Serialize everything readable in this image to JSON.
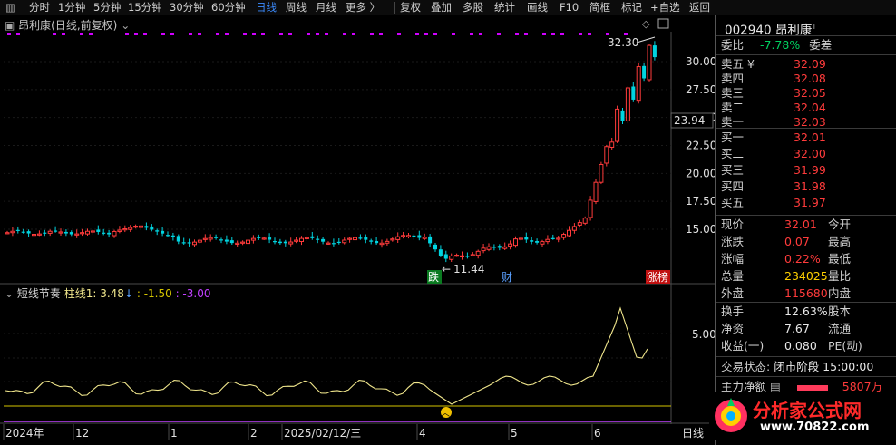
{
  "toolbar": {
    "items": [
      "分时",
      "1分钟",
      "5分钟",
      "15分钟",
      "30分钟",
      "60分钟",
      "日线",
      "周线",
      "月线",
      "更多 〉",
      "复权",
      "叠加",
      "多股",
      "统计",
      "画线",
      "F10",
      "简框",
      "标记",
      "+自选",
      "返回"
    ],
    "active": "日线"
  },
  "chart": {
    "title": "昂利康(日线,前复权)",
    "y_ticks": [
      "30.00",
      "27.50",
      "25.00",
      "22.50",
      "20.00",
      "17.50",
      "15.00"
    ],
    "cursor_price": "23.94",
    "high_label": "32.30",
    "low_label": "11.44",
    "markers": {
      "die": "跌",
      "cai": "财",
      "zhangbang": "涨榜"
    },
    "x_labels": [
      "2024年",
      "12",
      "1",
      "2",
      "2025/02/12/三",
      "4",
      "5",
      "6"
    ],
    "period_button": "日线"
  },
  "indicator": {
    "name": "短线节奏",
    "column_label": "柱线1: 3.48",
    "arrow": "↓",
    "value2": ": -1.50",
    "value3": ": -3.00",
    "y_tick": "5.00"
  },
  "panel": {
    "stock_code": "002940",
    "stock_name": "昂利康",
    "weibi_label": "委比",
    "weibi_value": "-7.78%",
    "weicha_label": "委差",
    "sell": [
      {
        "label": "卖五",
        "price": "32.09",
        "mark": "¥"
      },
      {
        "label": "卖四",
        "price": "32.08",
        "mark": ""
      },
      {
        "label": "卖三",
        "price": "32.05",
        "mark": ""
      },
      {
        "label": "卖二",
        "price": "32.04",
        "mark": ""
      },
      {
        "label": "卖一",
        "price": "32.03",
        "mark": ""
      }
    ],
    "buy": [
      {
        "label": "买一",
        "price": "32.01"
      },
      {
        "label": "买二",
        "price": "32.00"
      },
      {
        "label": "买三",
        "price": "31.99"
      },
      {
        "label": "买四",
        "price": "31.98"
      },
      {
        "label": "买五",
        "price": "31.97"
      }
    ],
    "stats": [
      {
        "l1": "现价",
        "v1": "32.01",
        "c1": "red",
        "l2": "今开"
      },
      {
        "l1": "涨跌",
        "v1": "0.07",
        "c1": "red",
        "l2": "最高"
      },
      {
        "l1": "涨幅",
        "v1": "0.22%",
        "c1": "red",
        "l2": "最低"
      },
      {
        "l1": "总量",
        "v1": "234025",
        "c1": "yellow",
        "l2": "量比"
      },
      {
        "l1": "外盘",
        "v1": "115680",
        "c1": "red",
        "l2": "内盘"
      }
    ],
    "stats2": [
      {
        "l1": "换手",
        "v1": "12.63%",
        "l2": "股本"
      },
      {
        "l1": "净资",
        "v1": "7.67",
        "l2": "流通"
      },
      {
        "l1": "收益(一)",
        "v1": "0.080",
        "l2": "PE(动)"
      }
    ],
    "status_label": "交易状态:",
    "status_value": "闭市阶段 15:00:00",
    "main_flow_label": "主力净额",
    "main_flow_value": "5807万"
  },
  "watermark": {
    "title": "分析家公式网",
    "url": "www.70822.com"
  },
  "colors": {
    "up": "#ff3b3b",
    "down": "#00d4e0",
    "indicator_line": "#f0e68c",
    "baseline_yellow": "#d4c400",
    "baseline_purple": "#c040ff",
    "dots": "#d000ff"
  }
}
